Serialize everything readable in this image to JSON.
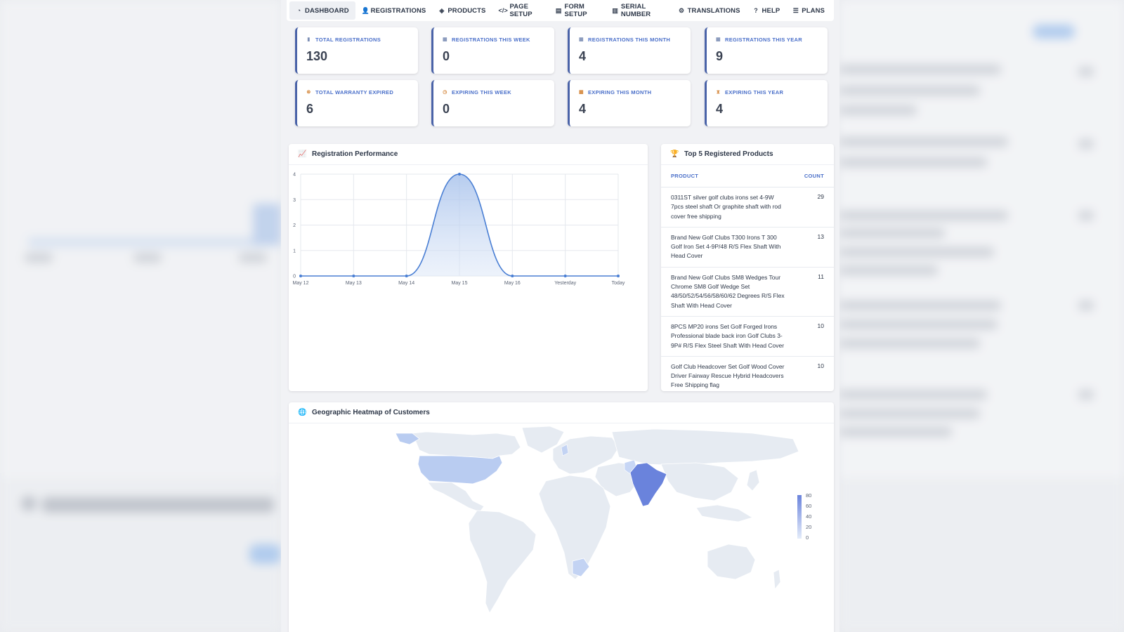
{
  "nav": {
    "items": [
      {
        "label": "DASHBOARD",
        "icon": "dashboard-icon"
      },
      {
        "label": "REGISTRATIONS",
        "icon": "user-plus-icon"
      },
      {
        "label": "PRODUCTS",
        "icon": "cube-icon"
      },
      {
        "label": "PAGE SETUP",
        "icon": "code-icon"
      },
      {
        "label": "FORM SETUP",
        "icon": "form-icon"
      },
      {
        "label": "SERIAL NUMBER",
        "icon": "barcode-icon"
      },
      {
        "label": "TRANSLATIONS",
        "icon": "gear-icon"
      },
      {
        "label": "HELP",
        "icon": "question-icon"
      }
    ],
    "plans_label": "PLANS"
  },
  "stats": [
    {
      "label": "TOTAL REGISTRATIONS",
      "value": "130",
      "icon": "clipboard-icon"
    },
    {
      "label": "REGISTRATIONS THIS WEEK",
      "value": "0",
      "icon": "calendar-icon"
    },
    {
      "label": "REGISTRATIONS THIS MONTH",
      "value": "4",
      "icon": "calendar-icon"
    },
    {
      "label": "REGISTRATIONS THIS YEAR",
      "value": "9",
      "icon": "calendar-icon"
    },
    {
      "label": "TOTAL WARRANTY EXPIRED",
      "value": "6",
      "icon": "circle-x-icon"
    },
    {
      "label": "EXPIRING THIS WEEK",
      "value": "0",
      "icon": "clock-icon"
    },
    {
      "label": "EXPIRING THIS MONTH",
      "value": "4",
      "icon": "calendar-icon"
    },
    {
      "label": "EXPIRING THIS YEAR",
      "value": "4",
      "icon": "hourglass-icon"
    }
  ],
  "performance": {
    "title": "Registration Performance"
  },
  "chart_data": {
    "type": "area",
    "categories": [
      "May 12",
      "May 13",
      "May 14",
      "May 15",
      "May 16",
      "Yesterday",
      "Today"
    ],
    "values": [
      0,
      0,
      0,
      4,
      0,
      0,
      0
    ],
    "ylim": [
      0,
      4
    ],
    "yticks": [
      "0",
      "1",
      "2",
      "3",
      "4"
    ],
    "grid": true
  },
  "top_products": {
    "title": "Top 5 Registered Products",
    "col_product": "PRODUCT",
    "col_count": "COUNT",
    "rows": [
      {
        "name": "0311ST silver golf clubs irons set 4-9W 7pcs steel shaft Or graphite shaft with rod cover free shipping",
        "count": "29"
      },
      {
        "name": "Brand New Golf Clubs T300 Irons T 300 Golf Iron Set 4-9P/48 R/S Flex Shaft With Head Cover",
        "count": "13"
      },
      {
        "name": "Brand New Golf Clubs SM8 Wedges Tour Chrome SM8 Golf Wedge Set 48/50/52/54/56/58/60/62 Degrees R/S Flex Shaft With Head Cover",
        "count": "11"
      },
      {
        "name": "8PCS MP20 irons Set Golf Forged Irons Professional blade back iron Golf Clubs 3-9P# R/S Flex Steel Shaft With Head Cover",
        "count": "10"
      },
      {
        "name": "Golf Club Headcover Set Golf Wood Cover Driver Fairway Rescue Hybrid Headcovers Free Shipping flag",
        "count": "10"
      }
    ]
  },
  "heatmap": {
    "title": "Geographic Heatmap of Customers",
    "scale_labels": [
      "80",
      "60",
      "40",
      "20",
      "0"
    ],
    "colors": {
      "land": "#e6ebf2",
      "low": "#dbe5f7",
      "mid": "#b9ccf1",
      "high": "#6a83dc"
    }
  }
}
